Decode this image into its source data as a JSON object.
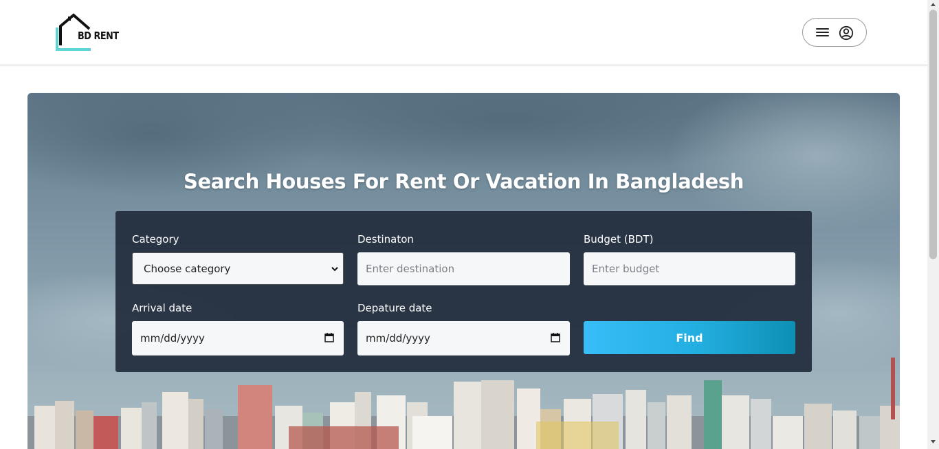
{
  "brand": {
    "logo_text": "BD RENT"
  },
  "header": {
    "menu_icon": "hamburger-icon",
    "account_icon": "account-circle-icon"
  },
  "hero": {
    "title": "Search Houses For Rent Or Vacation In Bangladesh",
    "form": {
      "category": {
        "label": "Category",
        "value": "Choose category"
      },
      "destination": {
        "label": "Destinaton",
        "placeholder": "Enter destination"
      },
      "budget": {
        "label": "Budget (BDT)",
        "placeholder": "Enter budget"
      },
      "arrival": {
        "label": "Arrival date",
        "value": "mm/dd/yyyy"
      },
      "departure": {
        "label": "Depature date",
        "value": "mm/dd/yyyy"
      },
      "find_label": "Find"
    }
  },
  "colors": {
    "accent": "#38bdf8",
    "panel": "#232e3e",
    "logo_teal": "#5fd3d6"
  }
}
